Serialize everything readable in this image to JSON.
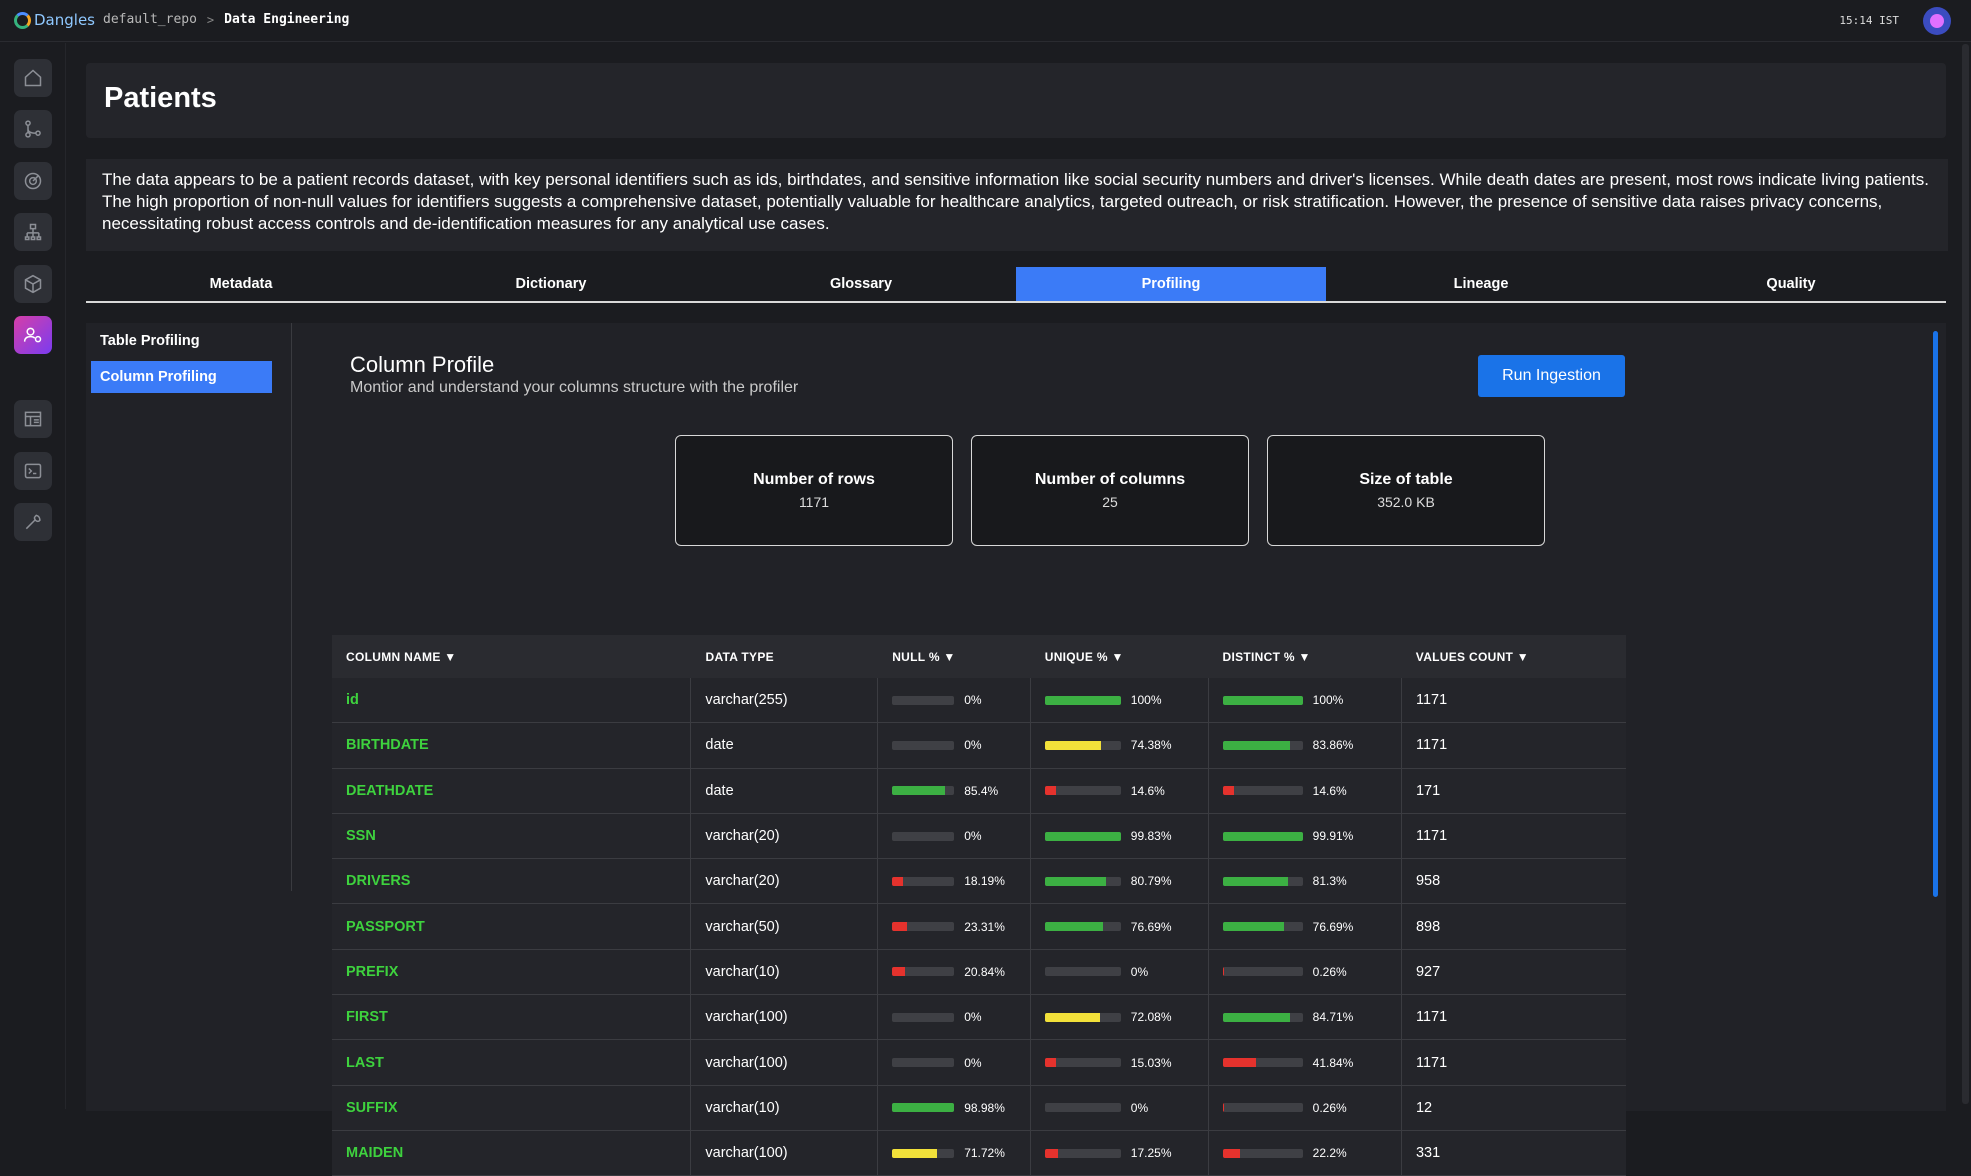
{
  "app": {
    "name": "Dangles",
    "breadcrumb": [
      "default_repo",
      "Data Engineering"
    ],
    "clock": "15:14 IST"
  },
  "nav": [
    "home-icon",
    "git-branch-icon",
    "radar-icon",
    "hierarchy-icon",
    "cube-icon",
    "user-settings-icon",
    "table-icon",
    "terminal-icon",
    "wrench-icon"
  ],
  "page": {
    "title": "Patients",
    "description": "The data appears to be a patient records dataset, with key personal identifiers such as ids, birthdates, and sensitive information like social security numbers and driver's licenses. While death dates are present, most rows indicate living patients. The high proportion of non-null values for identifiers suggests a comprehensive dataset, potentially valuable for healthcare analytics, targeted outreach, or risk stratification. However, the presence of sensitive data raises privacy concerns, necessitating robust access controls and de-identification measures for any analytical use cases."
  },
  "tabs": [
    "Metadata",
    "Dictionary",
    "Glossary",
    "Profiling",
    "Lineage",
    "Quality"
  ],
  "active_tab": "Profiling",
  "left_menu": [
    "Table Profiling",
    "Column Profiling"
  ],
  "profile": {
    "title": "Column Profile",
    "subtitle": "Montior and understand your columns structure with the profiler",
    "run_button": "Run Ingestion",
    "stats": [
      {
        "label": "Number of rows",
        "value": "1171"
      },
      {
        "label": "Number of columns",
        "value": "25"
      },
      {
        "label": "Size of table",
        "value": "352.0 KB"
      }
    ]
  },
  "table": {
    "headers": [
      "COLUMN NAME ▼",
      "DATA TYPE",
      "NULL % ▼",
      "UNIQUE % ▼",
      "DISTINCT % ▼",
      "VALUES COUNT ▼"
    ],
    "rows": [
      {
        "name": "id",
        "type": "varchar(255)",
        "null": "0%",
        "unique": "100%",
        "distinct": "100%",
        "count": "1171"
      },
      {
        "name": "BIRTHDATE",
        "type": "date",
        "null": "0%",
        "unique": "74.38%",
        "distinct": "83.86%",
        "count": "1171"
      },
      {
        "name": "DEATHDATE",
        "type": "date",
        "null": "85.4%",
        "unique": "14.6%",
        "distinct": "14.6%",
        "count": "171"
      },
      {
        "name": "SSN",
        "type": "varchar(20)",
        "null": "0%",
        "unique": "99.83%",
        "distinct": "99.91%",
        "count": "1171"
      },
      {
        "name": "DRIVERS",
        "type": "varchar(20)",
        "null": "18.19%",
        "unique": "80.79%",
        "distinct": "81.3%",
        "count": "958"
      },
      {
        "name": "PASSPORT",
        "type": "varchar(50)",
        "null": "23.31%",
        "unique": "76.69%",
        "distinct": "76.69%",
        "count": "898"
      },
      {
        "name": "PREFIX",
        "type": "varchar(10)",
        "null": "20.84%",
        "unique": "0%",
        "distinct": "0.26%",
        "count": "927"
      },
      {
        "name": "FIRST",
        "type": "varchar(100)",
        "null": "0%",
        "unique": "72.08%",
        "distinct": "84.71%",
        "count": "1171"
      },
      {
        "name": "LAST",
        "type": "varchar(100)",
        "null": "0%",
        "unique": "15.03%",
        "distinct": "41.84%",
        "count": "1171"
      },
      {
        "name": "SUFFIX",
        "type": "varchar(10)",
        "null": "98.98%",
        "unique": "0%",
        "distinct": "0.26%",
        "count": "12"
      },
      {
        "name": "MAIDEN",
        "type": "varchar(100)",
        "null": "71.72%",
        "unique": "17.25%",
        "distinct": "22.2%",
        "count": "331"
      }
    ]
  },
  "colors": {
    "accent": "#3b7bf7",
    "green": "#3cb043",
    "yellow": "#f2e13a",
    "red": "#e5322d",
    "name_green": "#3ed23e"
  }
}
